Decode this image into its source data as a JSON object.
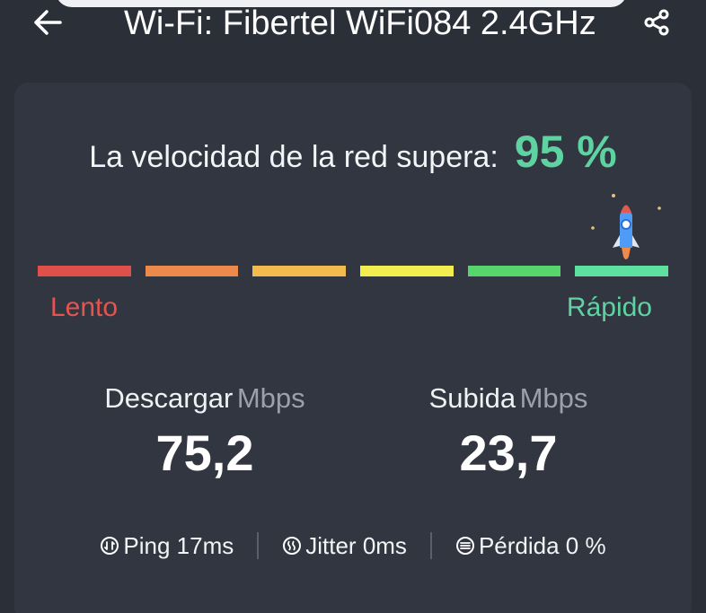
{
  "header": {
    "back_icon": "arrow-left-icon",
    "title": "Wi-Fi: Fibertel WiFi084 2.4GHz",
    "share_icon": "share-icon"
  },
  "speed": {
    "label": "La velocidad de la red supera:",
    "percent": "95 %",
    "percent_value": 95
  },
  "scale": {
    "low_label": "Lento",
    "high_label": "Rápido",
    "segments": [
      "#e0504b",
      "#ec8a4c",
      "#f2bb4d",
      "#f3ee4f",
      "#58d46d",
      "#5ee0a0"
    ],
    "rocket_icon": "rocket-icon"
  },
  "metrics": {
    "download": {
      "label": "Descargar",
      "unit": "Mbps",
      "value": "75,2"
    },
    "upload": {
      "label": "Subida",
      "unit": "Mbps",
      "value": "23,7"
    }
  },
  "stats": {
    "ping": "Ping 17ms",
    "jitter": "Jitter 0ms",
    "loss": "Pérdida 0 %"
  },
  "colors": {
    "accent": "#5ed3a1",
    "slow": "#e5544e",
    "background": "#2a2f38",
    "card": "#313641"
  }
}
